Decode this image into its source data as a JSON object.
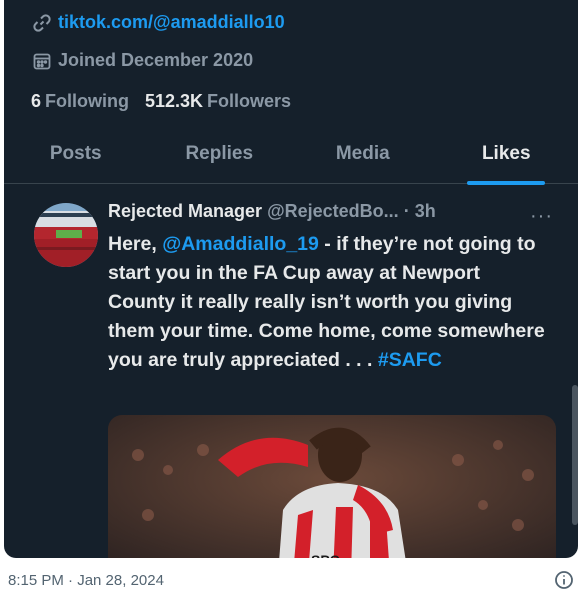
{
  "profile": {
    "link": "tiktok.com/@amaddiallo10",
    "joined": "Joined December 2020",
    "following_count": "6",
    "following_label": "Following",
    "followers_count": "512.3K",
    "followers_label": "Followers"
  },
  "tabs": [
    {
      "label": "Posts"
    },
    {
      "label": "Replies"
    },
    {
      "label": "Media"
    },
    {
      "label": "Likes",
      "active": true
    }
  ],
  "tweet": {
    "author": "Rejected Manager",
    "handle": "@RejectedBo...",
    "sep": "·",
    "time": "3h",
    "more": "···",
    "text_before": "Here, ",
    "mention": "@Amaddiallo_19",
    "text_middle": " - if they’re not going to start you in the FA Cup away at Newport County it really really isn’t worth you giving them your time. Come home, come somewhere you are truly appreciated . . . ",
    "hashtag": "#SAFC"
  },
  "footer": {
    "timestamp": "8:15 PM · Jan 28, 2024"
  },
  "icons": {
    "link": "link-icon",
    "calendar": "calendar-icon",
    "info": "info-icon"
  },
  "colors": {
    "background": "#15202b",
    "accent": "#1d9bf0",
    "primary_text": "#e7e9ea",
    "secondary_text": "#8b98a5"
  }
}
